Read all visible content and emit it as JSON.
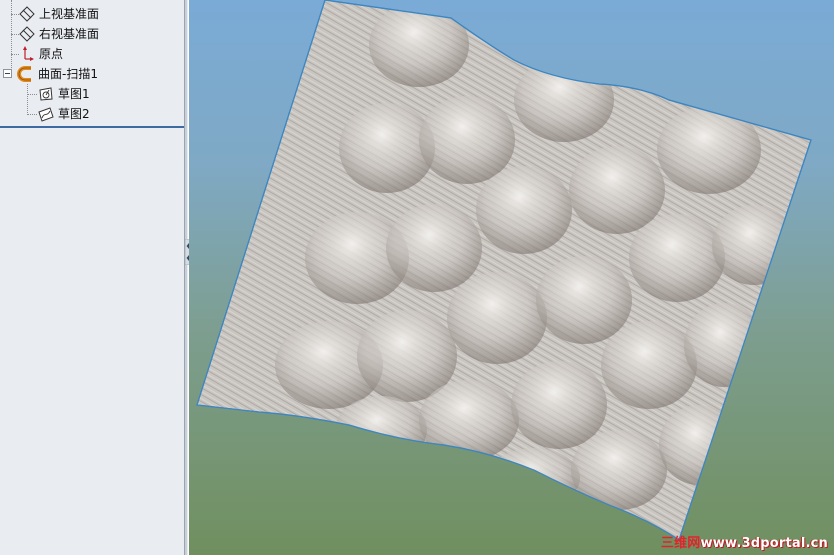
{
  "feature_tree": {
    "items": [
      {
        "label": "上视基准面",
        "icon": "plane-icon"
      },
      {
        "label": "右视基准面",
        "icon": "plane-icon"
      },
      {
        "label": "原点",
        "icon": "origin-icon"
      },
      {
        "label": "曲面-扫描1",
        "icon": "sweep-surface-icon"
      },
      {
        "label": "草图1",
        "icon": "sketch-icon"
      },
      {
        "label": "草图2",
        "icon": "sketch-icon"
      }
    ]
  },
  "watermark": {
    "cn": "三维网",
    "en": "www.3dportal.cn"
  },
  "colors": {
    "tree_bg": "#e9ecf1",
    "selection_line": "#3e6aa3",
    "surface": "#c8c4bf",
    "surface_shadow": "#8f8782",
    "surface_edge": "#3c86c2",
    "watermark_red": "#e0242b"
  }
}
